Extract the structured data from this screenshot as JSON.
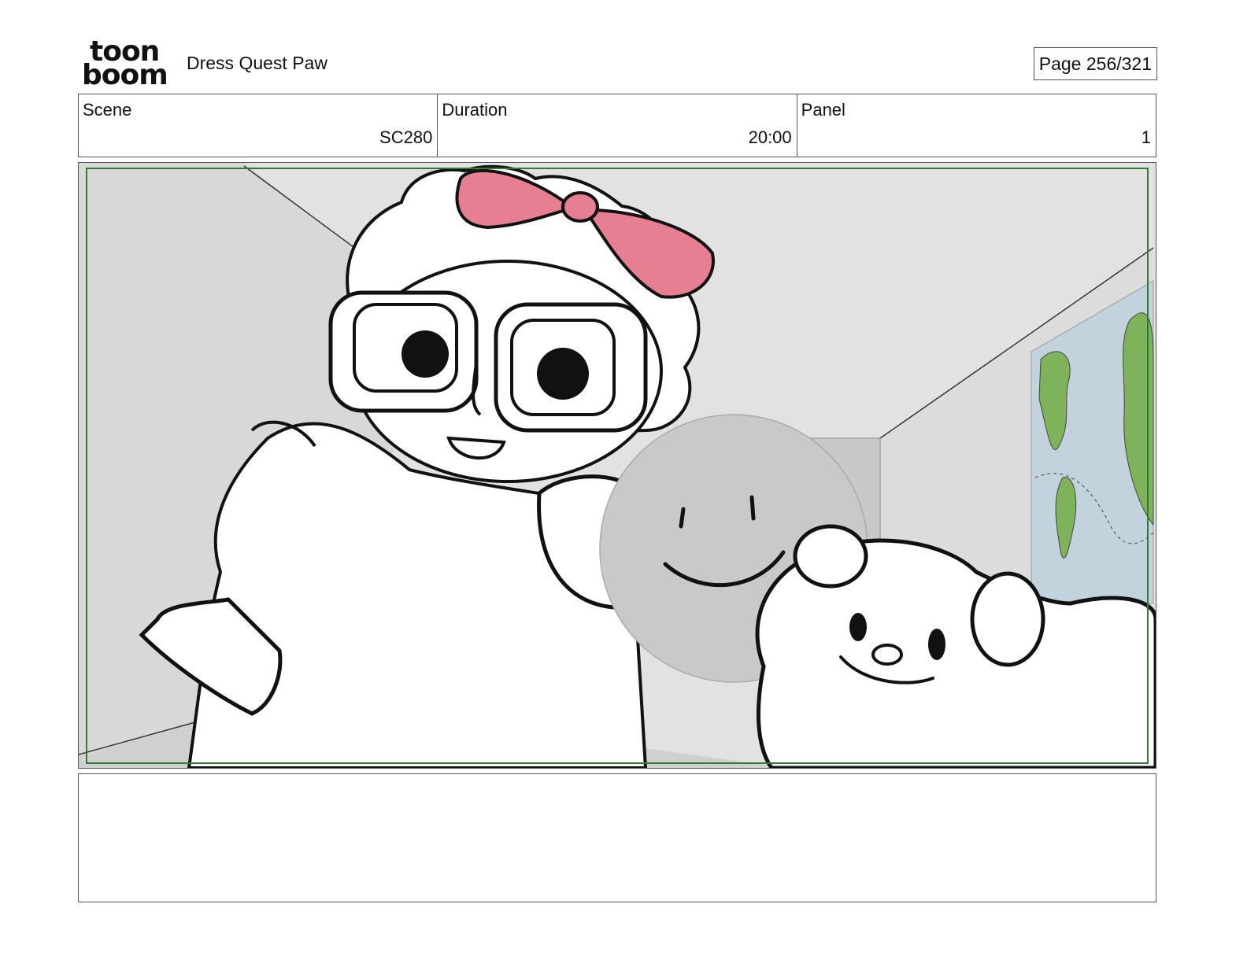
{
  "header": {
    "logo_top": "toon",
    "logo_bottom": "boom",
    "project_title": "Dress Quest Paw",
    "page_indicator": "Page 256/321"
  },
  "info": {
    "scene_label": "Scene",
    "scene_value": "SC280",
    "duration_label": "Duration",
    "duration_value": "20:00",
    "panel_label": "Panel",
    "panel_value": "1"
  },
  "colors": {
    "safe_frame": "#2e7d32",
    "bow": "#e77f92",
    "wall": "#e2e2e2",
    "floor": "#d6d6d6",
    "map_water": "#c3d3de",
    "map_land": "#7fb35b",
    "ball": "#c9c9c9"
  },
  "notes": {
    "text": ""
  }
}
